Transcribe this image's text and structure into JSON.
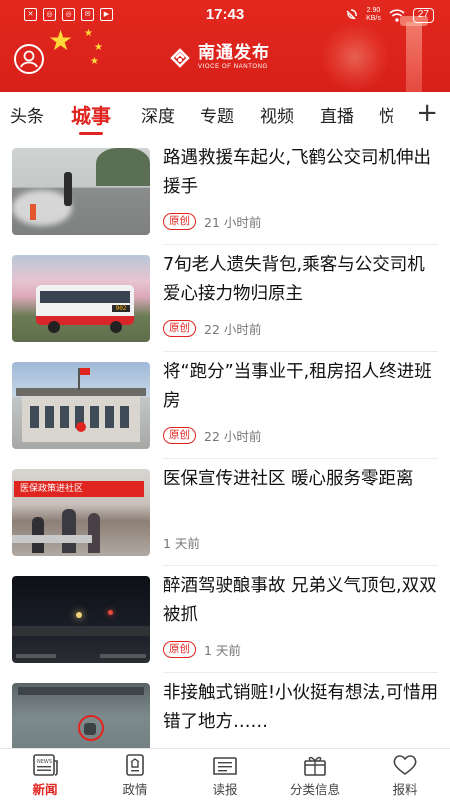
{
  "status_bar": {
    "time": "17:43",
    "speed_value": "2.90",
    "speed_unit": "KB/s",
    "battery": "27",
    "left_icons": [
      "app-notification-icon",
      "app-notification-icon",
      "app-notification-icon",
      "email-icon",
      "video-icon"
    ]
  },
  "header": {
    "brand_name": "南通发布",
    "brand_subtitle": "VIOCE OF NANTONG",
    "accent_color": "#e0241f"
  },
  "tabs": {
    "items": [
      "头条",
      "城事",
      "深度",
      "专题",
      "视频",
      "直播",
      "悦"
    ],
    "active": "城事",
    "more_label": "+"
  },
  "news": [
    {
      "title": "路遇救援车起火,飞鹤公交司机伸出援手",
      "badge": "原创",
      "time": "21 小时前"
    },
    {
      "title": "7旬老人遗失背包,乘客与公交司机爱心接力物归原主",
      "badge": "原创",
      "time": "22 小时前"
    },
    {
      "title": "将“跑分”当事业干,租房招人终进班房",
      "badge": "原创",
      "time": "22 小时前"
    },
    {
      "title": "医保宣传进社区 暖心服务零距离",
      "badge": "",
      "time": "1 天前"
    },
    {
      "title": "醉酒驾驶酿事故 兄弟义气顶包,双双被抓",
      "badge": "原创",
      "time": "1 天前"
    },
    {
      "title": "非接触式销赃!小伙挺有想法,可惜用错了地方……",
      "badge": "",
      "time": ""
    }
  ],
  "thumb_texts": {
    "bus_sign": "902",
    "banner": "医保政策进社区"
  },
  "bottom_nav": {
    "items": [
      "新闻",
      "政情",
      "读报",
      "分类信息",
      "报料"
    ],
    "active": "新闻",
    "news_icon_text": "NEWS"
  }
}
